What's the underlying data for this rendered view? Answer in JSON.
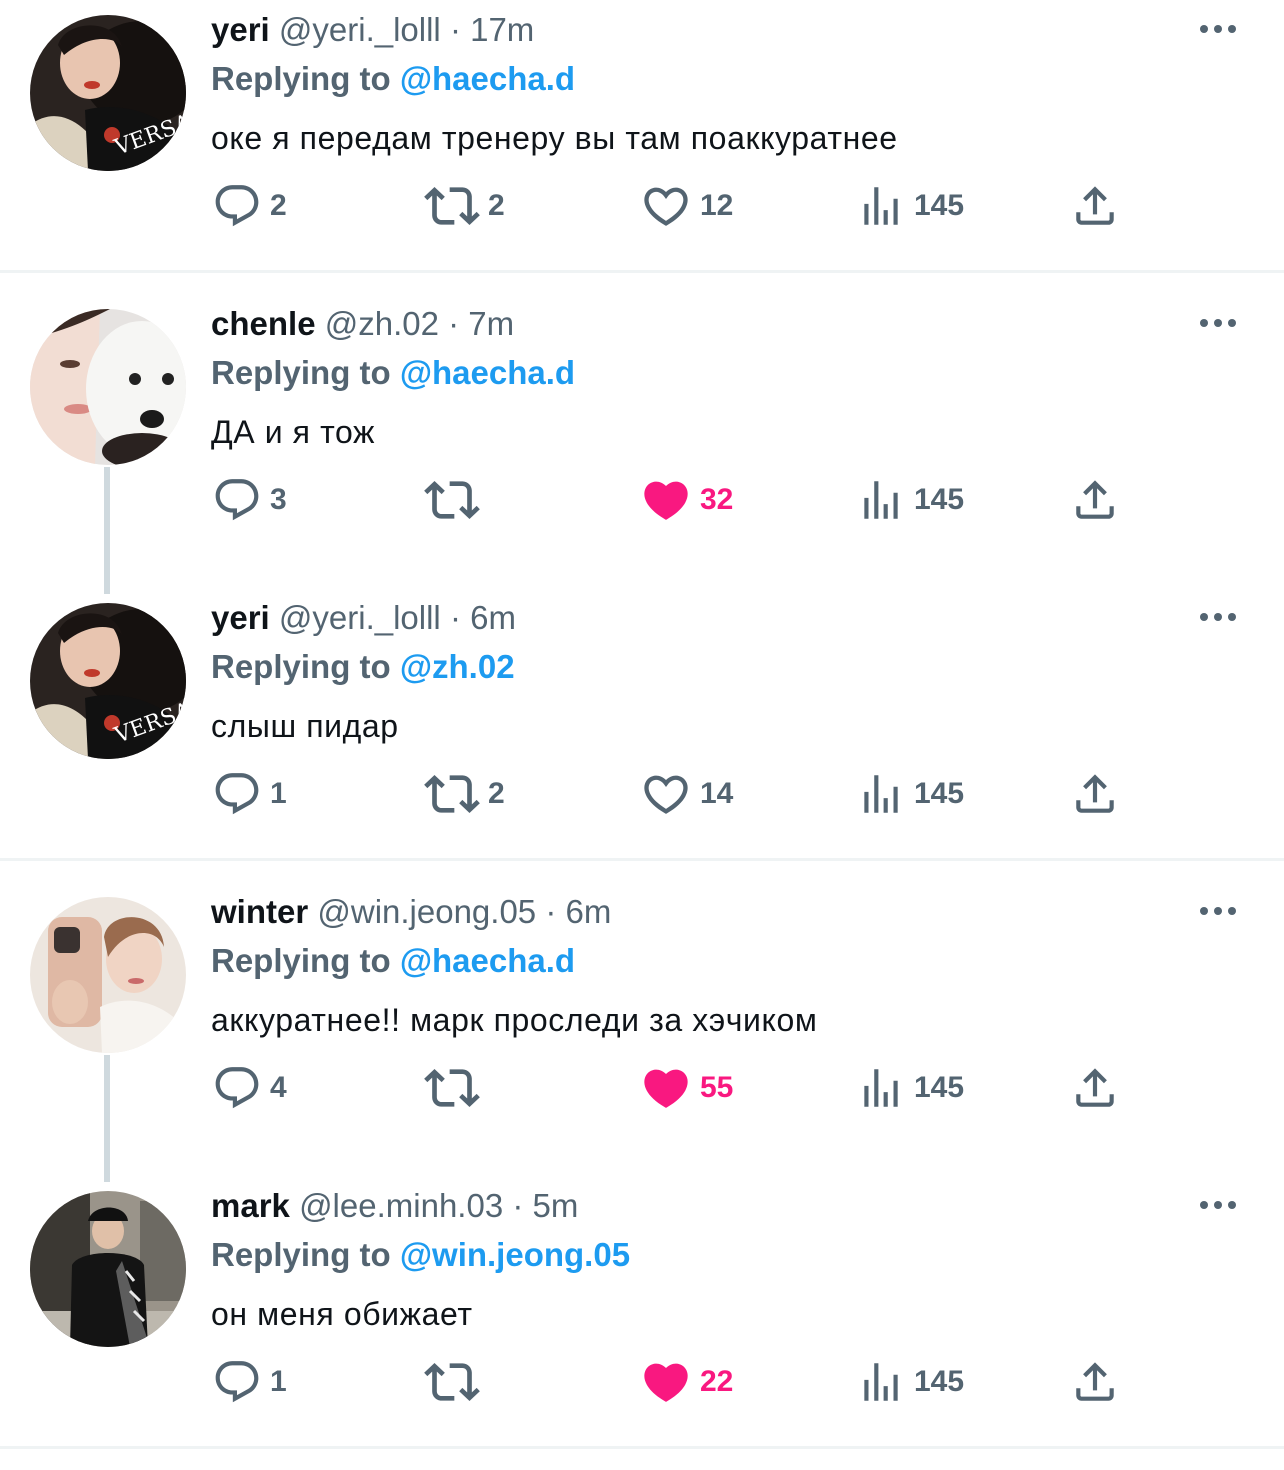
{
  "colors": {
    "link": "#1d9bf0",
    "secondary_text": "#536471",
    "like_active": "#f91880",
    "divider": "#eff3f4"
  },
  "tweets": [
    {
      "name": "yeri",
      "handle": "@yeri._lolll",
      "time": "· 17m",
      "replying_prefix": "Replying to",
      "replying_to": "@haecha.d",
      "text": "оке я передам тренеру вы там поаккуратнее",
      "reply_count": "2",
      "retweet_count": "2",
      "like_count": "12",
      "view_count": "145",
      "liked": false,
      "avatar": "yeri-avatar"
    },
    {
      "name": "chenle",
      "handle": "@zh.02",
      "time": "· 7m",
      "replying_prefix": "Replying to",
      "replying_to": "@haecha.d",
      "text": "ДА и я тож",
      "reply_count": "3",
      "retweet_count": "",
      "like_count": "32",
      "view_count": "145",
      "liked": true,
      "avatar": "chenle-avatar"
    },
    {
      "name": "yeri",
      "handle": "@yeri._lolll",
      "time": "· 6m",
      "replying_prefix": "Replying to",
      "replying_to": "@zh.02",
      "text": "слыш пидар",
      "reply_count": "1",
      "retweet_count": "2",
      "like_count": "14",
      "view_count": "145",
      "liked": false,
      "avatar": "yeri-avatar"
    },
    {
      "name": "winter",
      "handle": "@win.jeong.05",
      "time": "· 6m",
      "replying_prefix": "Replying to",
      "replying_to": "@haecha.d",
      "text": "аккуратнее!! марк проследи за хэчиком",
      "reply_count": "4",
      "retweet_count": "",
      "like_count": "55",
      "view_count": "145",
      "liked": true,
      "avatar": "winter-avatar"
    },
    {
      "name": "mark",
      "handle": "@lee.minh.03",
      "time": "· 5m",
      "replying_prefix": "Replying to",
      "replying_to": "@win.jeong.05",
      "text": "он меня обижает",
      "reply_count": "1",
      "retweet_count": "",
      "like_count": "22",
      "view_count": "145",
      "liked": true,
      "avatar": "mark-avatar"
    }
  ]
}
